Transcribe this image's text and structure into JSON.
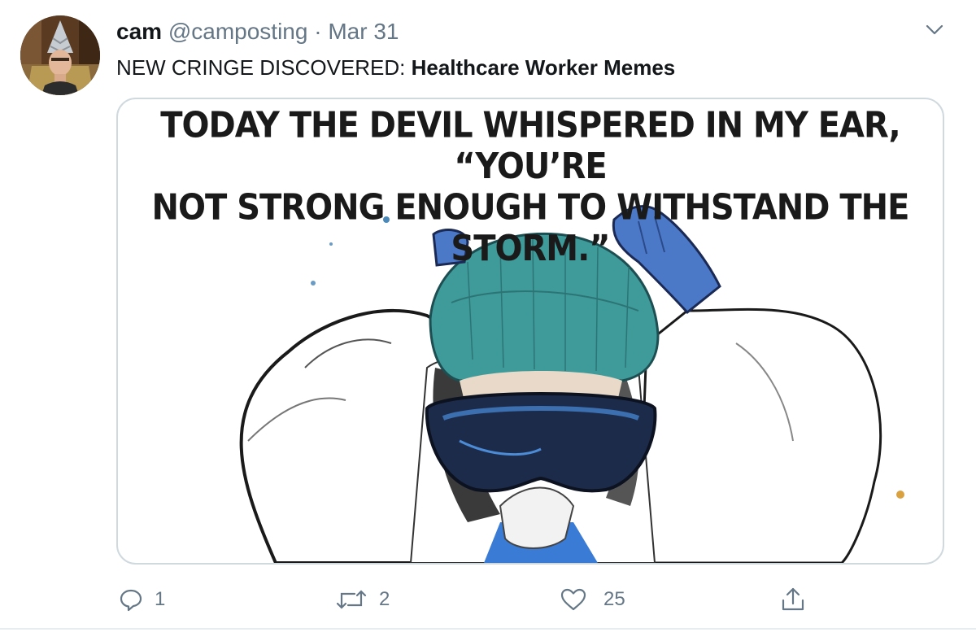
{
  "tweet": {
    "author_name": "cam",
    "author_handle": "@camposting",
    "separator": "·",
    "date": "Mar 31",
    "text_prefix": "NEW CRINGE DISCOVERED: ",
    "text_bold": "Healthcare Worker Memes",
    "avatar_icon": "tinfoil-hat-avatar",
    "menu_icon": "chevron-down-icon",
    "media": {
      "caption_line1": "TODAY THE DEVIL WHISPERED IN MY EAR, “YOU’RE",
      "caption_line2": "NOT STRONG ENOUGH TO WITHSTAND THE STORM.”",
      "illustration": "healthcare-worker-in-ppe-illustration"
    },
    "actions": {
      "reply_icon": "reply-icon",
      "reply_count": "1",
      "retweet_icon": "retweet-icon",
      "retweet_count": "2",
      "like_icon": "heart-icon",
      "like_count": "25",
      "share_icon": "share-icon"
    }
  },
  "colors": {
    "text_primary": "#14171a",
    "text_secondary": "#657786",
    "border": "#cfd9de",
    "scrub_cap": "#3f9a9a",
    "gloves": "#4b79c8"
  }
}
